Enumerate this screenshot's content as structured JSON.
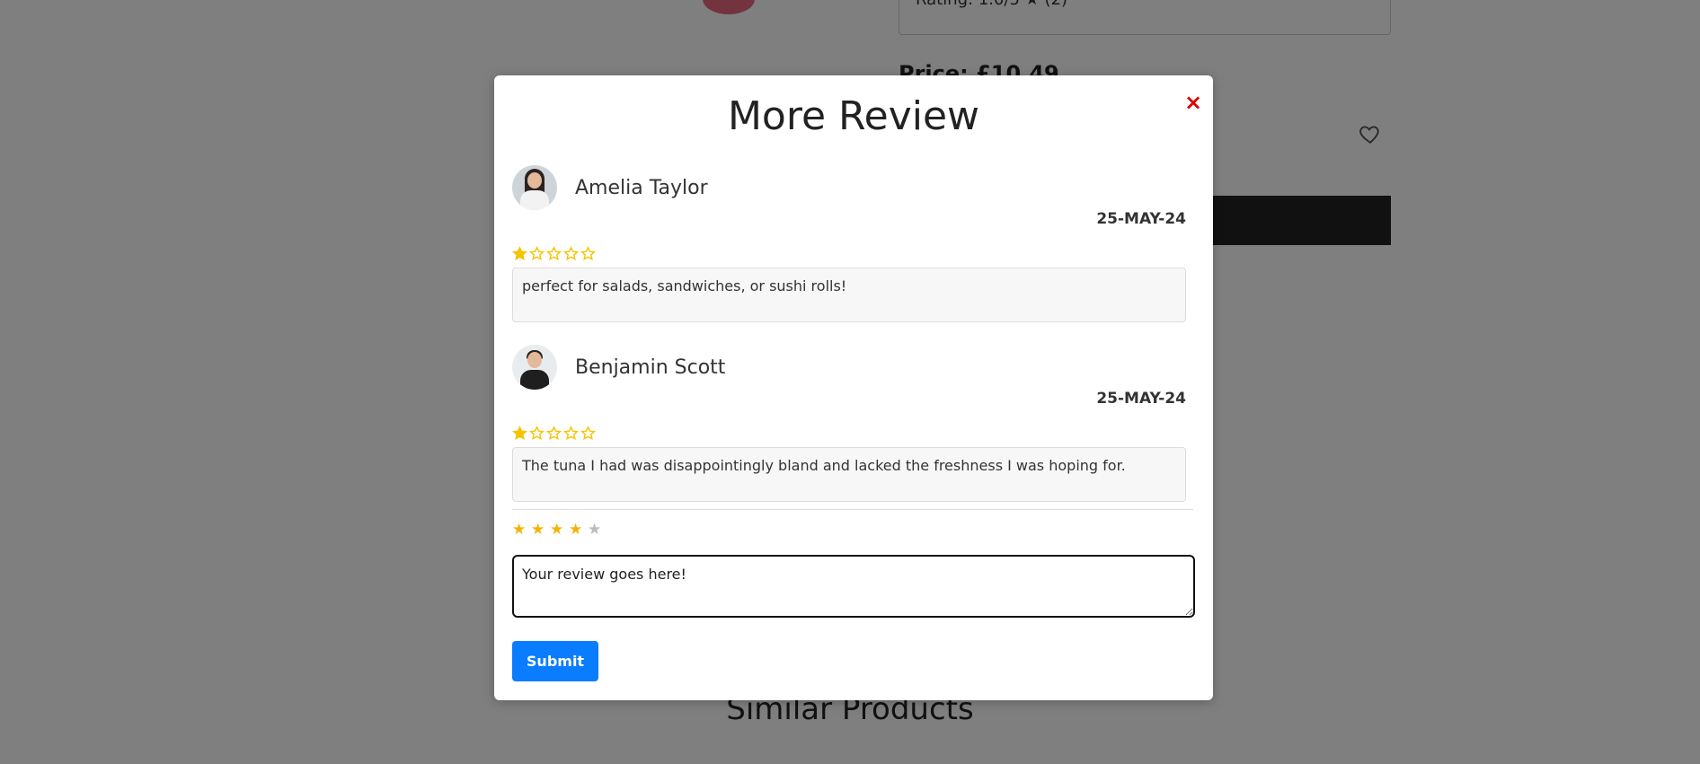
{
  "background": {
    "rating_text": "Rating: 1.0/5 ★ (2)",
    "price_text": "Price: £10.49",
    "similar_title": "Similar Products",
    "heart_icon": "heart-outline-icon"
  },
  "modal": {
    "title": "More Review",
    "close_symbol": "×",
    "reviews": [
      {
        "name": "Amelia Taylor",
        "date": "25-MAY-24",
        "rating": 1,
        "max_rating": 5,
        "text": "perfect for salads, sandwiches, or sushi rolls!"
      },
      {
        "name": "Benjamin Scott",
        "date": "25-MAY-24",
        "rating": 1,
        "max_rating": 5,
        "text": "The tuna I had was disappointingly bland and lacked the freshness I was hoping for."
      }
    ],
    "new_review": {
      "selected_rating": 4,
      "max_rating": 5,
      "value": "Your review goes here!",
      "placeholder": ""
    },
    "submit_label": "Submit"
  },
  "colors": {
    "star_gold": "#f5c400",
    "rate_star_on": "#f5b301",
    "rate_star_off": "#bbbbbb",
    "submit_blue": "#0a7cff",
    "close_red": "#e00000"
  }
}
